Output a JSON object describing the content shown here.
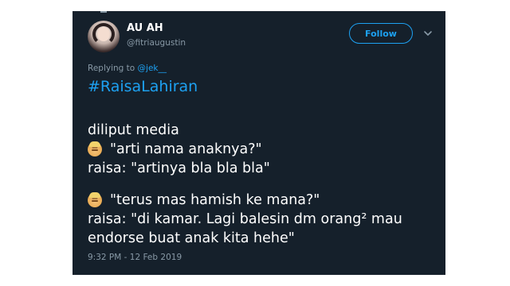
{
  "user": {
    "display_name": "AU AH",
    "handle": "@fitriaugustin"
  },
  "actions": {
    "follow_label": "Follow",
    "menu_icon": "chevron-down-icon"
  },
  "reply": {
    "prefix": "Replying to ",
    "mention": "@jek__"
  },
  "tweet": {
    "hashtag": "#RaisaLahiran",
    "lines": [
      "diliput media",
      "\"arti nama anaknya?\"",
      "raisa: \"artinya bla bla bla\"",
      "\"terus mas hamish ke mana?\"",
      "raisa: \"di kamar. Lagi balesin dm orang² mau",
      "endorse buat anak kita hehe\""
    ],
    "emoji": "man-emoji"
  },
  "timestamp": "9:32 PM - 12 Feb 2019",
  "colors": {
    "background": "#15202b",
    "accent": "#1da1f2",
    "muted": "#8899a6",
    "text": "#ffffff"
  }
}
